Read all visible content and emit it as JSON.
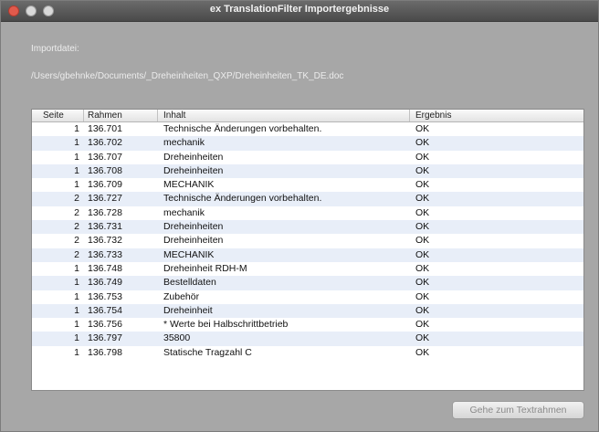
{
  "window": {
    "title": "ex TranslationFilter Importergebnisse",
    "accent": "#e05a4c"
  },
  "import": {
    "label": "Importdatei:",
    "path": "/Users/gbehnke/Documents/_Dreheinheiten_QXP/Dreheinheiten_TK_DE.doc"
  },
  "table": {
    "columns": [
      "Seite",
      "Rahmen",
      "Inhalt",
      "Ergebnis"
    ],
    "rows": [
      {
        "seite": "1",
        "rahmen": "136.701",
        "inhalt": "Technische Änderungen vorbehalten.",
        "ergebnis": "OK"
      },
      {
        "seite": "1",
        "rahmen": "136.702",
        "inhalt": "mechanik",
        "ergebnis": "OK"
      },
      {
        "seite": "1",
        "rahmen": "136.707",
        "inhalt": "Dreheinheiten",
        "ergebnis": "OK"
      },
      {
        "seite": "1",
        "rahmen": "136.708",
        "inhalt": "Dreheinheiten",
        "ergebnis": "OK"
      },
      {
        "seite": "1",
        "rahmen": "136.709",
        "inhalt": "MECHANIK",
        "ergebnis": "OK"
      },
      {
        "seite": "2",
        "rahmen": "136.727",
        "inhalt": "Technische Änderungen vorbehalten.",
        "ergebnis": "OK"
      },
      {
        "seite": "2",
        "rahmen": "136.728",
        "inhalt": "mechanik",
        "ergebnis": "OK"
      },
      {
        "seite": "2",
        "rahmen": "136.731",
        "inhalt": "Dreheinheiten",
        "ergebnis": "OK"
      },
      {
        "seite": "2",
        "rahmen": "136.732",
        "inhalt": "Dreheinheiten",
        "ergebnis": "OK"
      },
      {
        "seite": "2",
        "rahmen": "136.733",
        "inhalt": "MECHANIK",
        "ergebnis": "OK"
      },
      {
        "seite": "1",
        "rahmen": "136.748",
        "inhalt": "Dreheinheit RDH-M",
        "ergebnis": "OK"
      },
      {
        "seite": "1",
        "rahmen": "136.749",
        "inhalt": "Bestelldaten",
        "ergebnis": "OK"
      },
      {
        "seite": "1",
        "rahmen": "136.753",
        "inhalt": "Zubehör",
        "ergebnis": "OK"
      },
      {
        "seite": "1",
        "rahmen": "136.754",
        "inhalt": "Dreheinheit",
        "ergebnis": "OK"
      },
      {
        "seite": "1",
        "rahmen": "136.756",
        "inhalt": "* Werte bei Halbschrittbetrieb",
        "ergebnis": "OK"
      },
      {
        "seite": "1",
        "rahmen": "136.797",
        "inhalt": "35800",
        "ergebnis": "OK"
      },
      {
        "seite": "1",
        "rahmen": "136.798",
        "inhalt": "Statische Tragzahl C",
        "ergebnis": "OK"
      }
    ]
  },
  "footer": {
    "goto_label": "Gehe zum Textrahmen"
  }
}
